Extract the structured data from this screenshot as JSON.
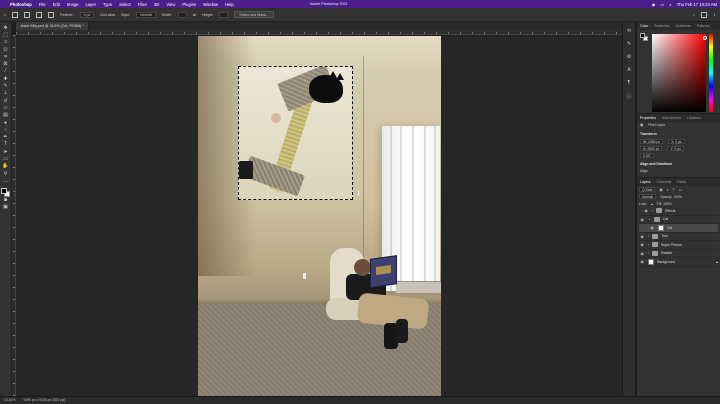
{
  "menubar": {
    "app": "Photoshop",
    "items": [
      "File",
      "Edit",
      "Image",
      "Layer",
      "Type",
      "Select",
      "Filter",
      "3D",
      "View",
      "Plugins",
      "Window",
      "Help"
    ],
    "clock": "Thu Feb 17  10:23 AM"
  },
  "window": {
    "title": "Adobe Photoshop 2021"
  },
  "options": {
    "feather_label": "Feather:",
    "feather_value": "0 px",
    "antialias": "Anti-alias",
    "style_label": "Style:",
    "style_value": "Normal",
    "width_label": "Width:",
    "height_label": "Height:",
    "select_mask": "Select and Mask..."
  },
  "doc_tab": "Jewel Kitty.psd @ 16.8% (Cat, RGB/8) *",
  "status": {
    "zoom": "16.81%",
    "size": "5496 px x 9438 px (300 ppi)"
  },
  "color_panel": {
    "tabs": [
      "Color",
      "Swatches",
      "Gradients",
      "Patterns"
    ],
    "picked": "#ff2b2b"
  },
  "properties": {
    "tabs": [
      "Properties",
      "Adjustments",
      "Libraries"
    ],
    "kind": "Pixel Layer",
    "transform_label": "Transform",
    "w": "W: 2496 px",
    "h": "H: 2694 px",
    "x": "X: 0 px",
    "y": "Y: 0 px",
    "angle": "0.00°",
    "align_label": "Align and Distribute",
    "align_sub": "Align:"
  },
  "layers_panel": {
    "tabs": [
      "Layers",
      "Channels",
      "Paths"
    ],
    "kind_label": "Q Kind",
    "blend": "Normal",
    "opacity": "Opacity: 100%",
    "lock": "Lock:",
    "fill": "Fill: 100%",
    "items": [
      {
        "name": "Effects",
        "type": "group",
        "level": 1
      },
      {
        "name": "Cat",
        "type": "group",
        "level": 0
      },
      {
        "name": "Cat",
        "type": "layer",
        "level": 1,
        "selected": true
      },
      {
        "name": "Tree",
        "type": "group",
        "level": 0
      },
      {
        "name": "Super Person",
        "type": "group",
        "level": 0
      },
      {
        "name": "Reader",
        "type": "group",
        "level": 0
      },
      {
        "name": "Background",
        "type": "layer",
        "level": 0
      }
    ]
  },
  "tools": [
    "move",
    "marquee",
    "lasso",
    "object-select",
    "crop",
    "frame",
    "eyedropper",
    "heal",
    "brush",
    "stamp",
    "history-brush",
    "eraser",
    "gradient",
    "blur",
    "dodge",
    "pen",
    "type",
    "path-select",
    "shape",
    "hand",
    "zoom",
    "more"
  ]
}
